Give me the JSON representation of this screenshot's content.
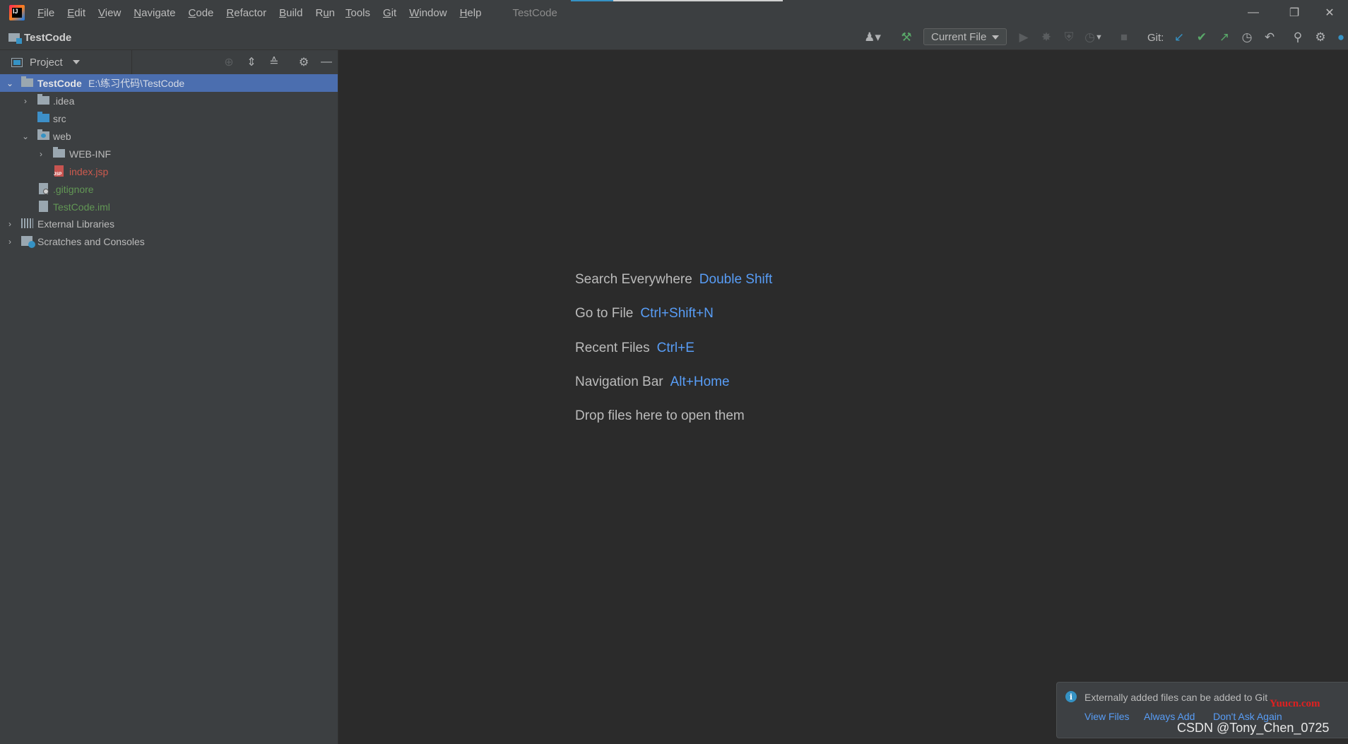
{
  "menubar": {
    "items": [
      {
        "pre": "",
        "mn": "F",
        "post": "ile"
      },
      {
        "pre": "",
        "mn": "E",
        "post": "dit"
      },
      {
        "pre": "",
        "mn": "V",
        "post": "iew"
      },
      {
        "pre": "",
        "mn": "N",
        "post": "avigate"
      },
      {
        "pre": "",
        "mn": "C",
        "post": "ode"
      },
      {
        "pre": "",
        "mn": "R",
        "post": "efactor"
      },
      {
        "pre": "",
        "mn": "B",
        "post": "uild"
      },
      {
        "pre": "R",
        "mn": "u",
        "post": "n"
      },
      {
        "pre": "",
        "mn": "T",
        "post": "ools"
      },
      {
        "pre": "",
        "mn": "G",
        "post": "it"
      },
      {
        "pre": "",
        "mn": "W",
        "post": "indow"
      },
      {
        "pre": "",
        "mn": "H",
        "post": "elp"
      }
    ],
    "window_title": "TestCode"
  },
  "navbar": {
    "project": "TestCode",
    "run_config": "Current File",
    "git_label": "Git:"
  },
  "project_panel": {
    "title": "Project",
    "root": {
      "label": "TestCode",
      "path": "E:\\练习代码\\TestCode"
    },
    "nodes": {
      "idea": ".idea",
      "src": "src",
      "web": "web",
      "webinf": "WEB-INF",
      "index": "index.jsp",
      "gitignore": ".gitignore",
      "iml": "TestCode.iml",
      "extlib": "External Libraries",
      "scratches": "Scratches and Consoles"
    },
    "colors": {
      "untracked": "#cd5a4e",
      "added": "#629755",
      "selection": "#4b6eaf"
    }
  },
  "editor": {
    "hints": [
      {
        "text": "Search Everywhere",
        "key": "Double Shift"
      },
      {
        "text": "Go to File",
        "key": "Ctrl+Shift+N"
      },
      {
        "text": "Recent Files",
        "key": "Ctrl+E"
      },
      {
        "text": "Navigation Bar",
        "key": "Alt+Home"
      }
    ],
    "drop_text": "Drop files here to open them"
  },
  "notification": {
    "message": "Externally added files can be added to Git",
    "actions": [
      "View Files",
      "Always Add",
      "Don't Ask Again"
    ]
  },
  "watermarks": {
    "red": "Yuucn.com",
    "csdn": "CSDN @Tony_Chen_0725"
  }
}
